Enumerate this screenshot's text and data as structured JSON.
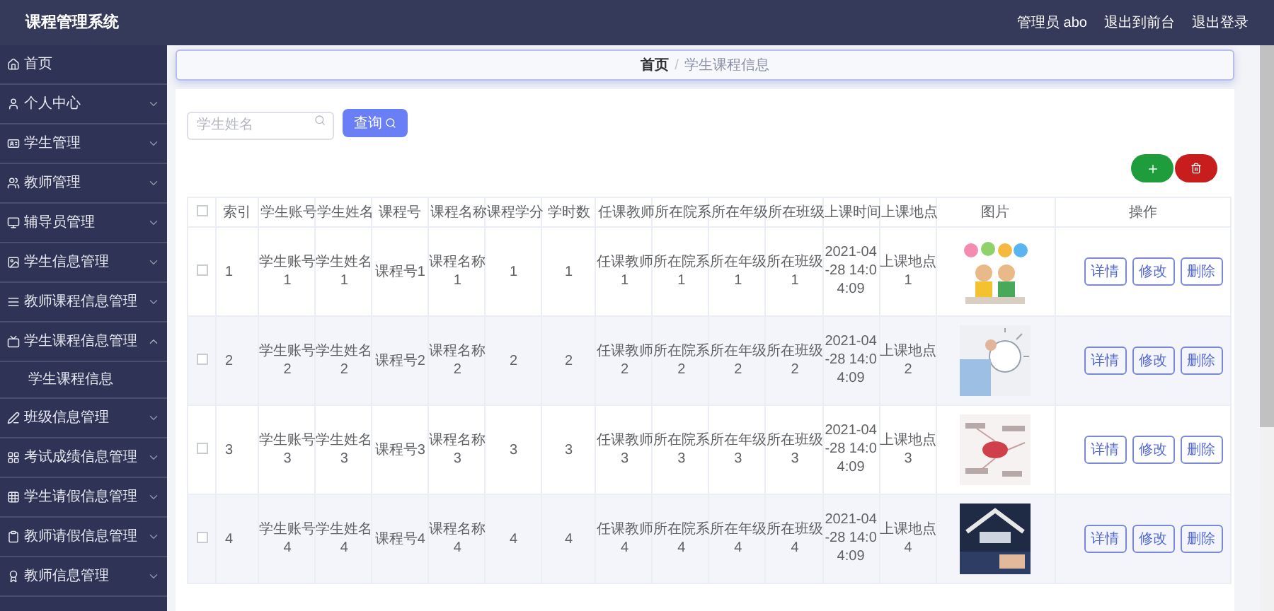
{
  "header": {
    "title": "课程管理系统",
    "user": "管理员 abo",
    "links": [
      "退出到前台",
      "退出登录"
    ]
  },
  "sidebar": {
    "items": [
      {
        "label": "首页",
        "kind": "link"
      },
      {
        "label": "个人中心",
        "kind": "menu",
        "expanded": false
      },
      {
        "label": "学生管理",
        "kind": "menu",
        "expanded": false
      },
      {
        "label": "教师管理",
        "kind": "menu",
        "expanded": false
      },
      {
        "label": "辅导员管理",
        "kind": "menu",
        "expanded": false
      },
      {
        "label": "学生信息管理",
        "kind": "menu",
        "expanded": false
      },
      {
        "label": "教师课程信息管理",
        "kind": "menu",
        "expanded": false
      },
      {
        "label": "学生课程信息管理",
        "kind": "menu",
        "expanded": true,
        "children": [
          {
            "label": "学生课程信息"
          }
        ]
      },
      {
        "label": "班级信息管理",
        "kind": "menu",
        "expanded": false
      },
      {
        "label": "考试成绩信息管理",
        "kind": "menu",
        "expanded": false
      },
      {
        "label": "学生请假信息管理",
        "kind": "menu",
        "expanded": false
      },
      {
        "label": "教师请假信息管理",
        "kind": "menu",
        "expanded": false
      },
      {
        "label": "教师信息管理",
        "kind": "menu",
        "expanded": false
      }
    ]
  },
  "breadcrumb": {
    "items": [
      "首页",
      "学生课程信息"
    ],
    "separator": "/"
  },
  "search": {
    "placeholder": "学生姓名",
    "button": "查询"
  },
  "table": {
    "select_all_checked": false,
    "columns": [
      "索引",
      "学生账号",
      "学生姓名",
      "课程号",
      "课程名称",
      "课程学分",
      "学时数",
      "任课教师",
      "所在院系",
      "所在年级",
      "所在班级",
      "上课时间",
      "上课地点",
      "图片",
      "操作"
    ],
    "rows": [
      {
        "checked": false,
        "cells": [
          "1",
          "学生账号\n1",
          "学生姓名\n1",
          "课程号1",
          "课程名称\n1",
          "1",
          "1",
          "任课教师\n1",
          "所在院系\n1",
          "所在年级\n1",
          "所在班级\n1",
          "2021-04\n-28 14:0\n4:09",
          "上课地点\n1"
        ],
        "picture": {
          "kind": "picture"
        },
        "actions": [
          "详情",
          "修改",
          "删除"
        ]
      },
      {
        "checked": false,
        "cells": [
          "2",
          "学生账号\n2",
          "学生姓名\n2",
          "课程号2",
          "课程名称\n2",
          "2",
          "2",
          "任课教师\n2",
          "所在院系\n2",
          "所在年级\n2",
          "所在班级\n2",
          "2021-04\n-28 14:0\n4:09",
          "上课地点\n2"
        ],
        "picture": {
          "kind": "picture"
        },
        "actions": [
          "详情",
          "修改",
          "删除"
        ]
      },
      {
        "checked": false,
        "cells": [
          "3",
          "学生账号\n3",
          "学生姓名\n3",
          "课程号3",
          "课程名称\n3",
          "3",
          "3",
          "任课教师\n3",
          "所在院系\n3",
          "所在年级\n3",
          "所在班级\n3",
          "2021-04\n-28 14:0\n4:09",
          "上课地点\n3"
        ],
        "picture": {
          "kind": "picture"
        },
        "actions": [
          "详情",
          "修改",
          "删除"
        ]
      },
      {
        "checked": false,
        "cells": [
          "4",
          "学生账号\n4",
          "学生姓名\n4",
          "课程号4",
          "课程名称\n4",
          "4",
          "4",
          "任课教师\n4",
          "所在院系\n4",
          "所在年级\n4",
          "所在班级\n4",
          "2021-04\n-28 14:0\n4:09",
          "上课地点\n4"
        ],
        "picture": {
          "kind": "picture"
        },
        "actions": [
          "详情",
          "修改",
          "删除"
        ]
      }
    ]
  }
}
